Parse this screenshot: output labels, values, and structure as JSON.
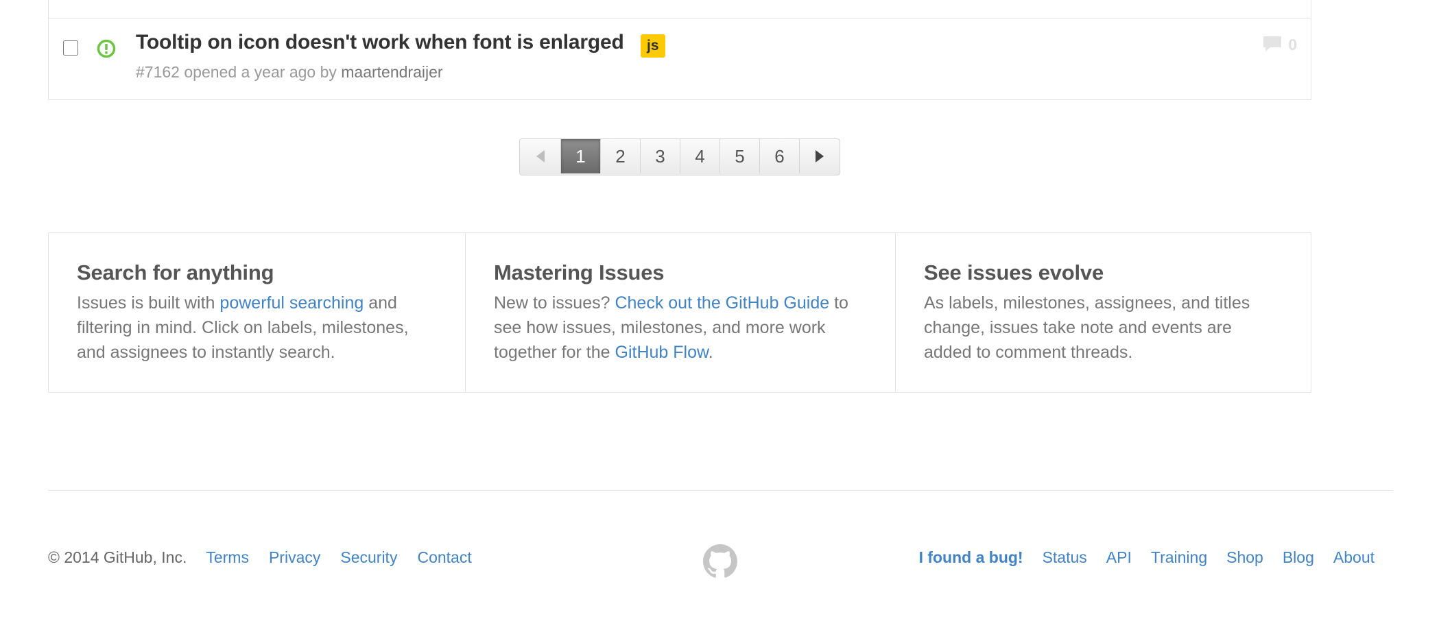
{
  "issue": {
    "title": "Tooltip on icon doesn't work when font is enlarged",
    "label": "js",
    "label_color": "#fbca04",
    "number": "#7162",
    "opened_text": "opened a year ago by",
    "author": "maartendraijer",
    "comment_count": "0",
    "status_color": "#6cc644",
    "icon": "issue-opened-icon"
  },
  "pagination": {
    "prev_icon": "chevron-left-icon",
    "next_icon": "chevron-right-icon",
    "pages": [
      "1",
      "2",
      "3",
      "4",
      "5",
      "6"
    ],
    "current": "1"
  },
  "tips": [
    {
      "heading": "Search for anything",
      "before": "Issues is built with ",
      "link": "powerful searching",
      "after": " and filtering in mind. Click on labels, milestones, and assignees to instantly search."
    },
    {
      "heading": "Mastering Issues",
      "before": "New to issues? ",
      "link": "Check out the GitHub Guide",
      "middle": " to see how issues, milestones, and more work together for the ",
      "link2": "GitHub Flow",
      "after": "."
    },
    {
      "heading": "See issues evolve",
      "text": "As labels, milestones, assignees, and titles change, issues take note and events are added to comment threads."
    }
  ],
  "footer": {
    "copyright": "© 2014 GitHub, Inc.",
    "left_links": [
      "Terms",
      "Privacy",
      "Security",
      "Contact"
    ],
    "logo_icon": "octocat-icon",
    "bug_link": "I found a bug!",
    "right_links": [
      "Status",
      "API",
      "Training",
      "Shop",
      "Blog",
      "About"
    ]
  },
  "colors": {
    "link": "#4183c4",
    "border": "#e5e5e5",
    "muted": "#999999"
  }
}
